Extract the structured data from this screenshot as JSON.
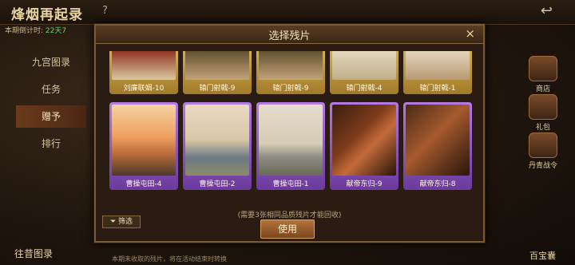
{
  "game": {
    "title": "烽烟再起录",
    "help": "?"
  },
  "countdown": {
    "label": "本期倒计时:",
    "value": "22天7"
  },
  "sidebar": [
    {
      "label": "九宫图录"
    },
    {
      "label": "任务"
    },
    {
      "label": "赠予",
      "active": true
    },
    {
      "label": "排行"
    }
  ],
  "right_icons": [
    {
      "label": "商店"
    },
    {
      "label": "礼包"
    },
    {
      "label": "丹青战令"
    }
  ],
  "bottom": {
    "left": "往昔图录",
    "right": "百宝囊",
    "note": "本期未收取的残片，将在活动结束时转换"
  },
  "modal": {
    "title": "选择残片",
    "close": "×",
    "hint": "(需要3张相同品质残片才能回收)",
    "filter": "筛选",
    "use": "使用"
  },
  "cards_row1": [
    {
      "label": "刘廉联姻-10",
      "tier": "gold"
    },
    {
      "label": "辕门射戟-9",
      "tier": "gold"
    },
    {
      "label": "辕门射戟-9",
      "tier": "gold"
    },
    {
      "label": "辕门射戟-4",
      "tier": "gold"
    },
    {
      "label": "辕门射戟-1",
      "tier": "gold"
    }
  ],
  "cards_row2": [
    {
      "label": "曹操屯田-4",
      "tier": "purple"
    },
    {
      "label": "曹操屯田-2",
      "tier": "purple"
    },
    {
      "label": "曹操屯田-1",
      "tier": "purple"
    },
    {
      "label": "献帝东归-9",
      "tier": "purple"
    },
    {
      "label": "献帝东归-8",
      "tier": "purple"
    }
  ]
}
